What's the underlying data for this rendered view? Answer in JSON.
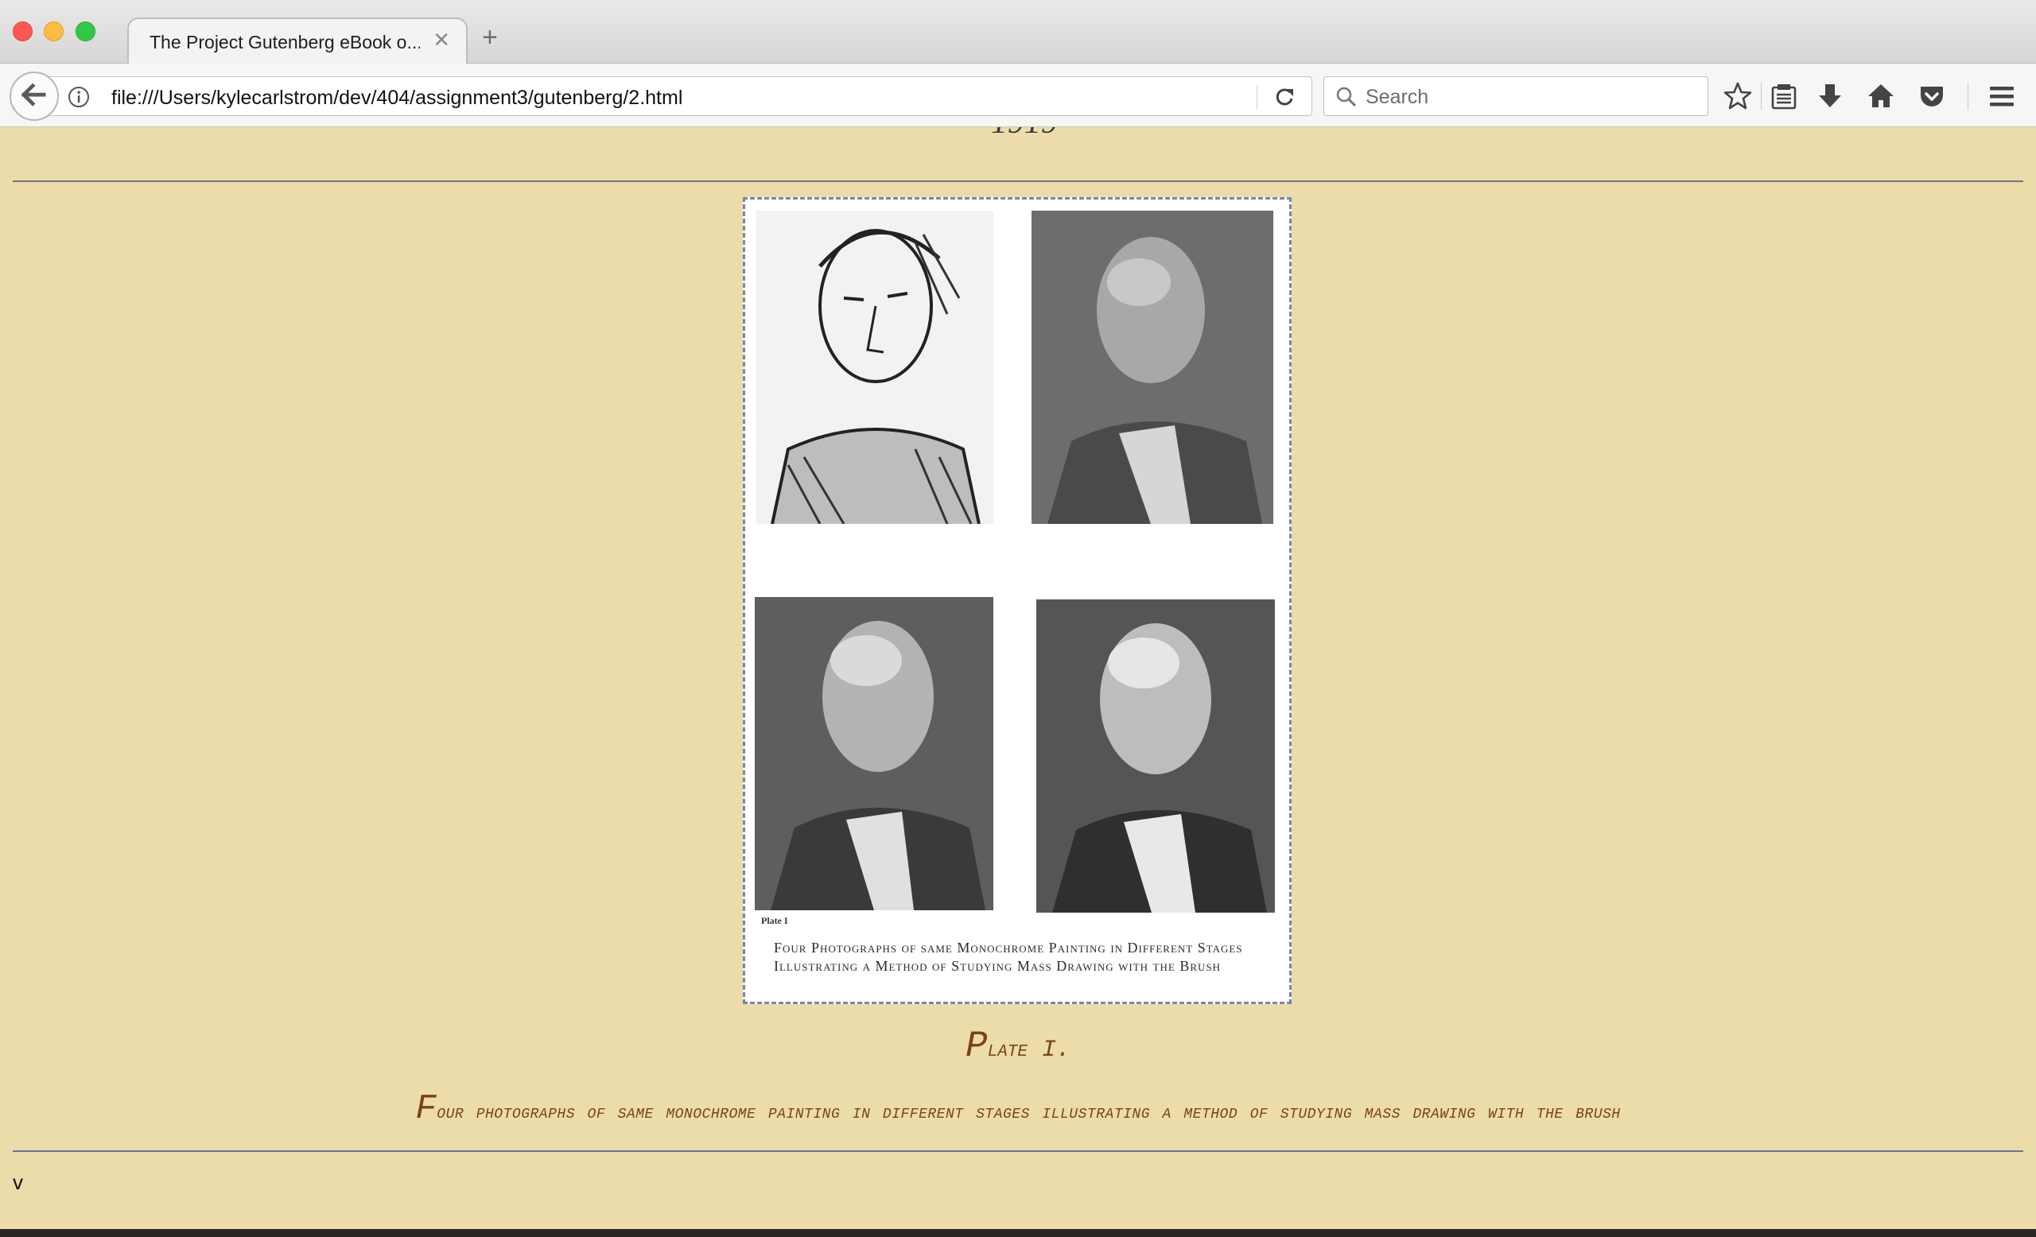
{
  "browser": {
    "tab_title": "The Project Gutenberg eBook o...",
    "tab_close_glyph": "✕",
    "new_tab_glyph": "+",
    "url": "file:///Users/kylecarlstrom/dev/404/assignment3/gutenberg/2.html",
    "search_placeholder": "Search",
    "icons": [
      "back-icon",
      "info-icon",
      "reload-icon",
      "search-icon",
      "bookmark-star-icon",
      "reading-list-icon",
      "download-icon",
      "home-icon",
      "pocket-icon",
      "menu-icon"
    ]
  },
  "page": {
    "background_color": "#ecdca9",
    "accent_color": "#7a4412",
    "top_fragment": "1919",
    "scan_plate_label": "Plate I",
    "scan_caption": "Four Photographs of same Monochrome Painting in Different Stages Illustrating a Method of Studying Mass Drawing with the Brush",
    "plate_title": "Plate I.",
    "plate_description": "Four photographs of same monochrome painting in different stages illustrating a method of studying mass drawing with the brush",
    "page_marker": "v"
  }
}
